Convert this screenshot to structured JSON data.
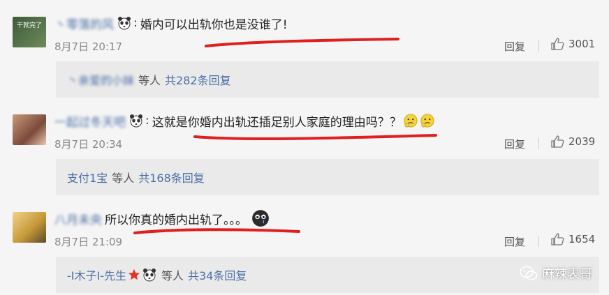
{
  "comments": [
    {
      "username": "丶零落的风",
      "username_prefix": "",
      "avatar_text": "干就完了",
      "text": "婚内可以出轨你也是没谁了!",
      "time": "8月7日 20:17",
      "reply_label": "回复",
      "likes": "3001",
      "sub": {
        "name": "丶亲爱的小妹",
        "etc": "等人",
        "count": "共282条回复"
      }
    },
    {
      "username": "一起过冬天吧",
      "username_prefix": "",
      "avatar_text": "",
      "text": "这就是你婚内出轨还插足别人家庭的理由吗？？",
      "time": "8月7日 20:34",
      "reply_label": "回复",
      "likes": "2039",
      "sub": {
        "name": "支付1宝",
        "etc": "等人",
        "count": "共168条回复"
      }
    },
    {
      "username": "八月未央",
      "username_prefix": "",
      "avatar_text": "",
      "text": "所以你真的婚内出轨了。。。",
      "time": "8月7日 21:09",
      "reply_label": "回复",
      "likes": "1654",
      "sub": {
        "name": "-I木子I-先生",
        "etc": "等人",
        "count": "共34条回复"
      }
    }
  ],
  "watermark": "麻辣表哥",
  "colors": {
    "link": "#4a6fa5",
    "underline": "#e02020",
    "sub_bg": "#eaeaea",
    "bg": "#f5f5f5"
  }
}
